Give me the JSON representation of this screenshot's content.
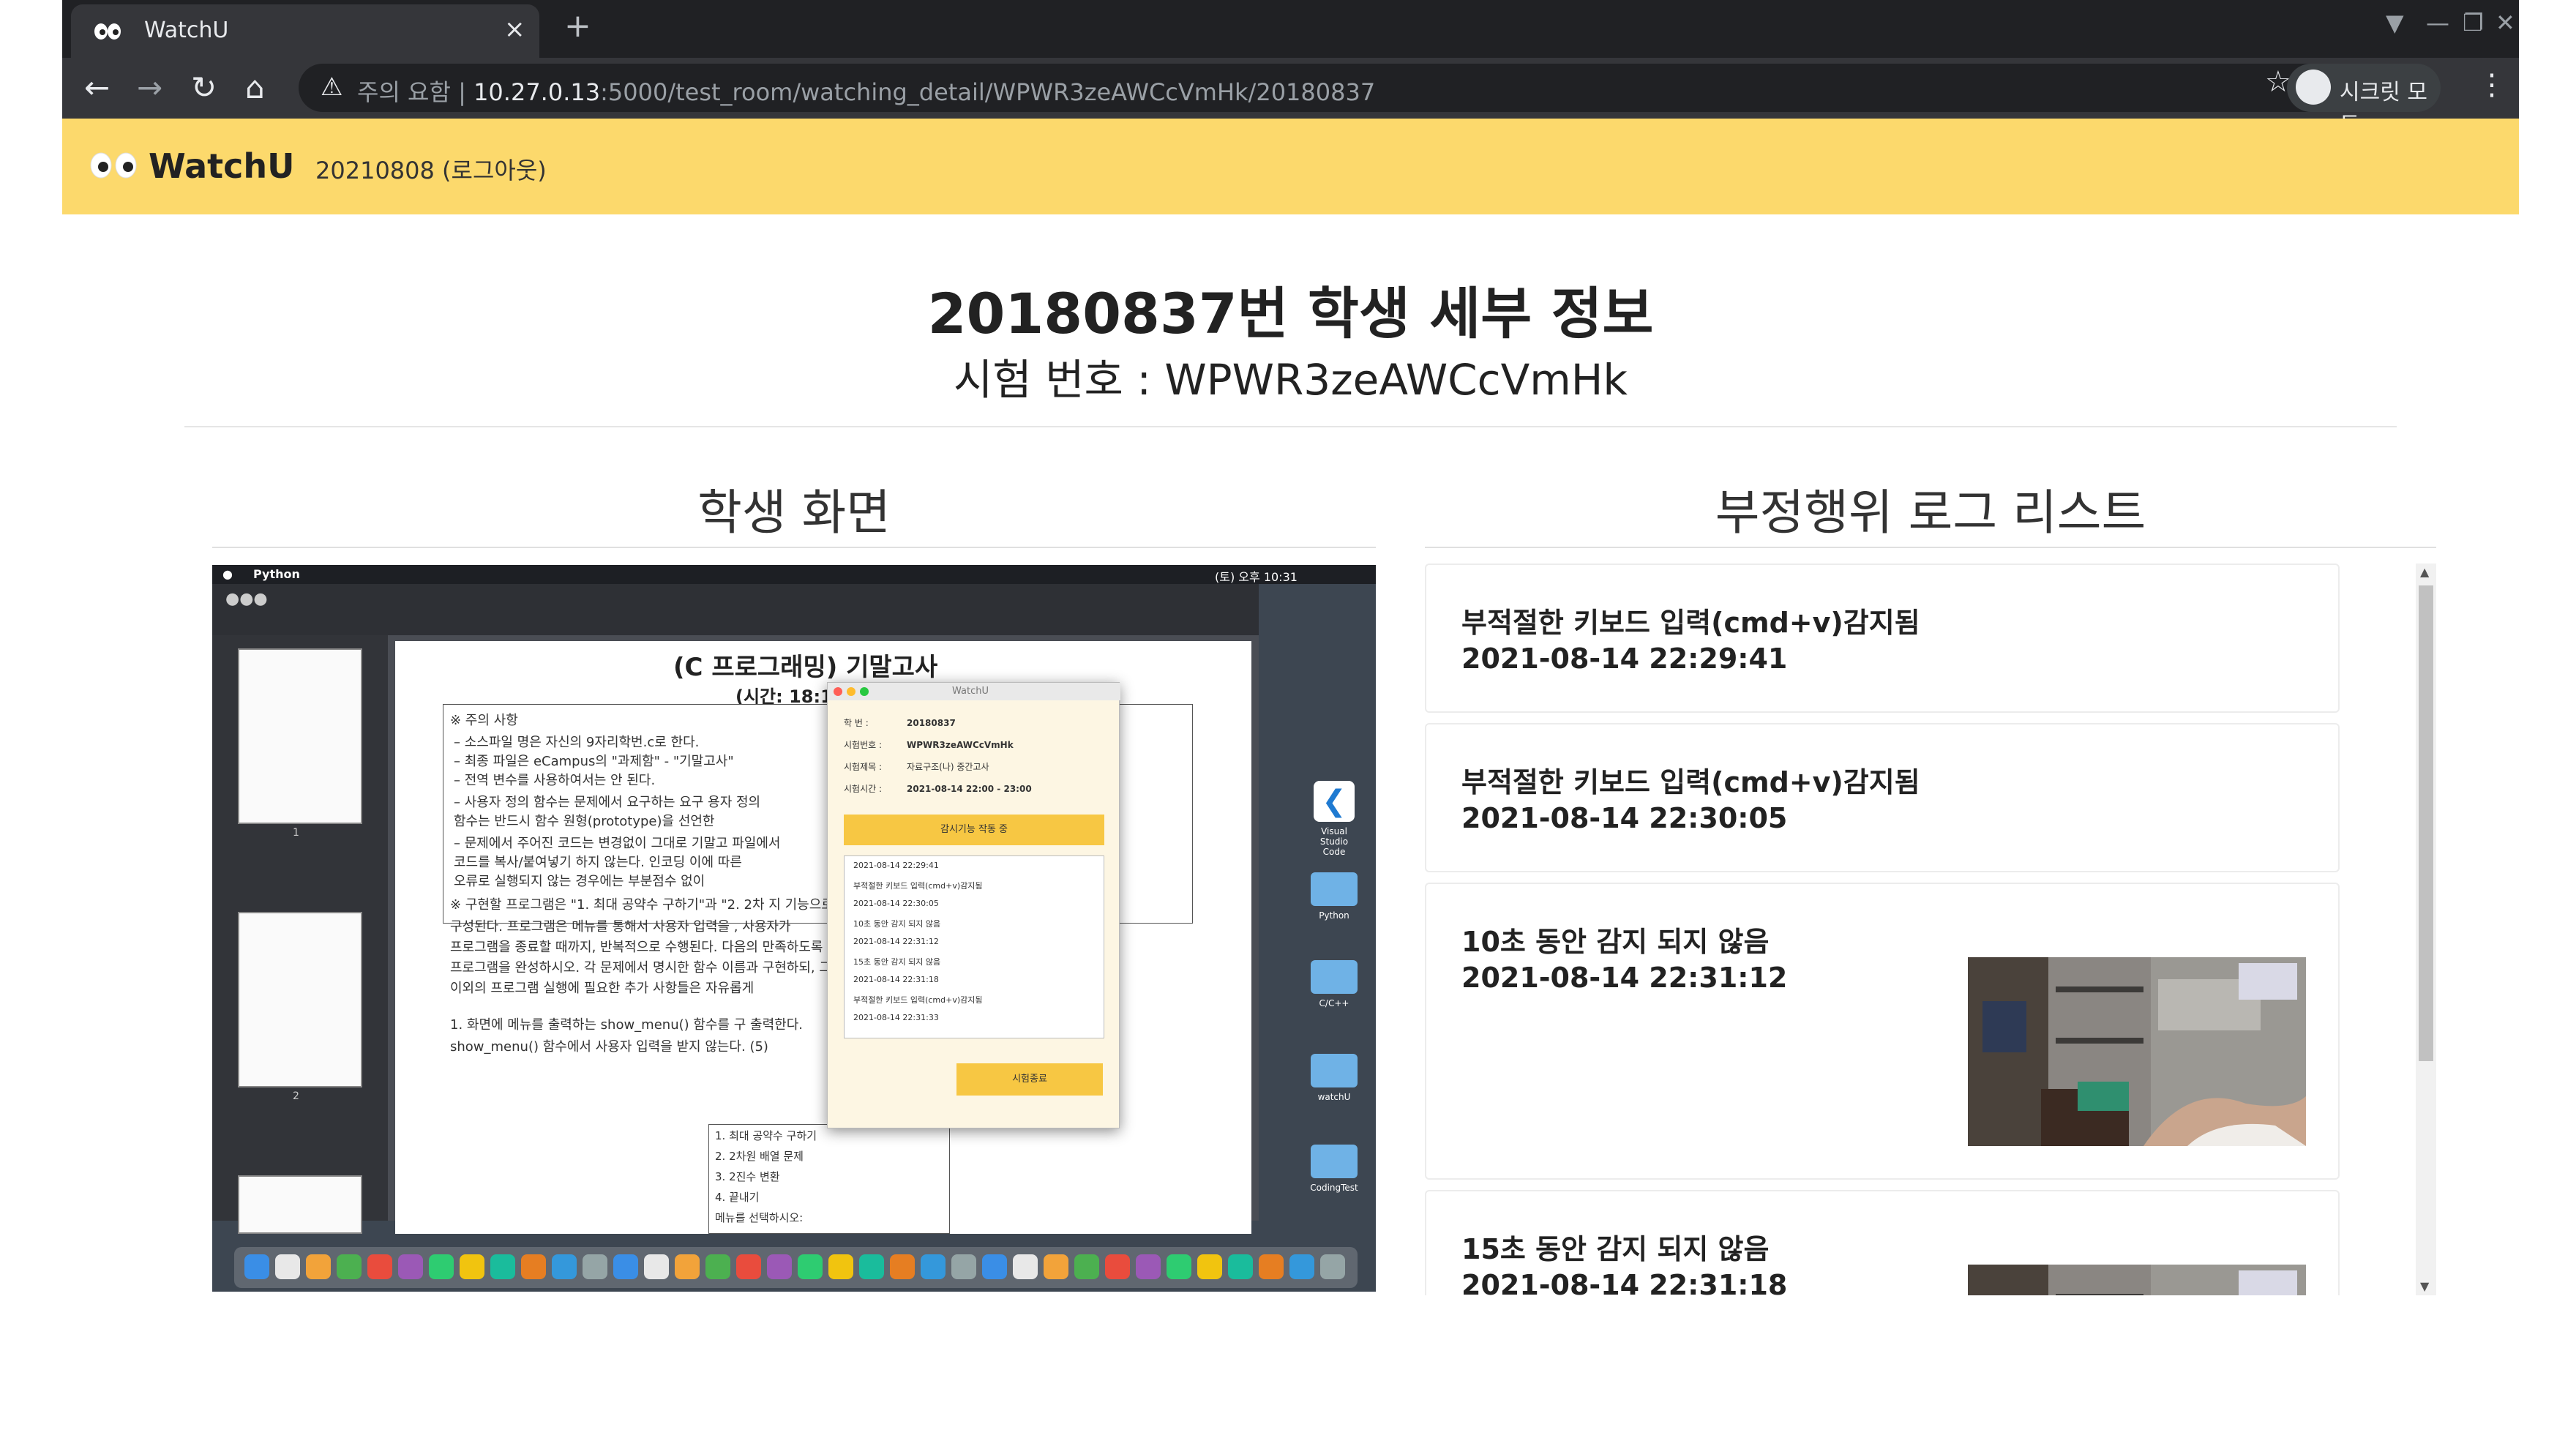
{
  "browser": {
    "tab_title": "WatchU",
    "tab_close": "×",
    "new_tab": "+",
    "url_warning": "주의 요함",
    "url_separator": "|",
    "url_host": "10.27.0.13",
    "url_rest": ":5000/test_room/watching_detail/WPWR3zeAWCcVmHk/20180837",
    "incognito_label": "시크릿 모드"
  },
  "navbar": {
    "brand": "WatchU",
    "user": "20210808 (로그아웃)"
  },
  "header": {
    "title": "20180837번 학생 세부 정보",
    "subtitle": "시험 번호 : WPWR3zeAWCcVmHk"
  },
  "left_section": {
    "title": "학생 화면",
    "screenshot": {
      "mac_app": "Python",
      "mac_clock": "(토) 오후 10:31",
      "doc_title": "(C 프로그래밍) 기말고사",
      "doc_subtitle": "(시간: 18:10",
      "doc_lines": [
        "※ 주의 사항",
        "–   소스파일 명은 자신의 9자리학번.c로 한다.",
        "–   최종 파일은 eCampus의 \"과제함\" - \"기말고사\"",
        "–   전역 변수를 사용하여서는 안 된다.",
        "–   사용자 정의 함수는 문제에서 요구하는 요구                  용자 정의",
        "     함수는 반드시 함수 원형(prototype)을 선언한",
        "–   문제에서 주어진 코드는 변경없이 그대로 기말고                  파일에서",
        "     코드를 복사/붙여넣기 하지 않는다. 인코딩                 이에 따른",
        "     오류로 실행되지 않는 경우에는 부분점수 없이",
        "※ 구현할 프로그램은 \"1. 최대 공약수 구하기\"과 \"2. 2차                 지 기능으로",
        "구성된다. 프로그램은 메뉴를 통해서 사용자 입력을                      , 사용자가",
        "프로그램을 종료할 때까지, 반복적으로 수행된다. 다음의                  만족하도록",
        "프로그램을 완성하시오. 각 문제에서 명시한 함수 이름과                 구현하되, 그",
        "이외의 프로그램 실행에 필요한 추가 사항들은 자유롭게",
        "1. 화면에 메뉴를 출력하는 show_menu() 함수를 구                  출력한다.",
        "show_menu() 함수에서 사용자 입력을 받지 않는다. (5)"
      ],
      "menu_lines": [
        "1. 최대 공약수 구하기",
        "2. 2차원 배열 문제",
        "3. 2진수 변환",
        "4. 끝내기",
        "메뉴를 선택하시오:"
      ],
      "popup": {
        "title": "WatchU",
        "rows": [
          {
            "label": "학    번 :",
            "value": "20180837"
          },
          {
            "label": "시험번호 :",
            "value": "WPWR3zeAWCcVmHk"
          },
          {
            "label": "시험제목 :",
            "value": "자료구조(나) 중간고사"
          },
          {
            "label": "시험시간 :",
            "value": "2021-08-14 22:00 - 23:00"
          }
        ],
        "status": "감시기능 작동 중",
        "log": [
          "2021-08-14 22:29:41",
          "부적절한 키보드 입력(cmd+v)감지됨",
          "2021-08-14 22:30:05",
          "10초 동안 감지 되지 않음",
          "2021-08-14 22:31:12",
          "15초 동안 감지 되지 않음",
          "2021-08-14 22:31:18",
          "부적절한 키보드 입력(cmd+v)감지됨",
          "2021-08-14 22:31:33"
        ],
        "end_button": "시험종료"
      },
      "desktop_icons": [
        "Visual Studio Code",
        "Python",
        "C/C++",
        "watchU",
        "CodingTest"
      ],
      "thumb_numbers": [
        "1",
        "2"
      ]
    }
  },
  "right_section": {
    "title": "부정행위 로그 리스트",
    "logs": [
      {
        "message": "부적절한 키보드 입력(cmd+v)감지됨",
        "time": "2021-08-14 22:29:41"
      },
      {
        "message": "부적절한 키보드 입력(cmd+v)감지됨",
        "time": "2021-08-14 22:30:05"
      },
      {
        "message": "10초 동안 감지 되지 않음",
        "time": "2021-08-14 22:31:12"
      },
      {
        "message": "15초 동안 감지 되지 않음",
        "time": "2021-08-14 22:31:18"
      }
    ]
  },
  "colors": {
    "navbar": "#fcd96c",
    "tab_bar": "#202124",
    "popup_accent": "#f7c743"
  }
}
